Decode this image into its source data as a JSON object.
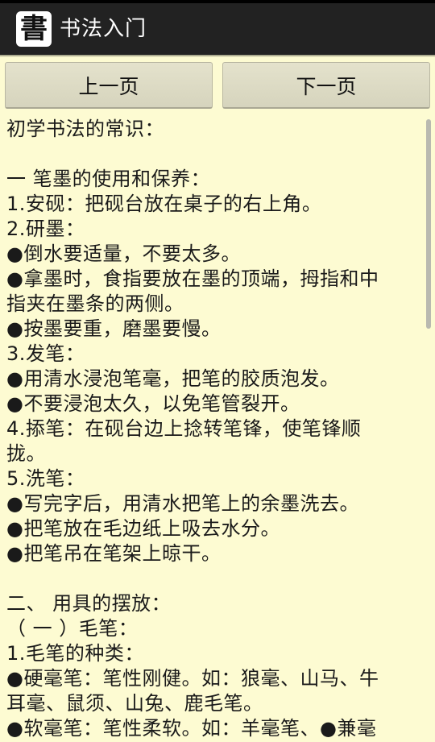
{
  "app_bar": {
    "icon_char": "書",
    "title": "书法入门"
  },
  "nav": {
    "prev_label": "上一页",
    "next_label": "下一页"
  },
  "content": {
    "lines": [
      "初学书法的常识：",
      "",
      "一 笔墨的使用和保养：",
      "1.安砚：把砚台放在桌子的右上角。",
      "2.研墨：",
      "●倒水要适量，不要太多。",
      "●拿墨时，食指要放在墨的顶端，拇指和中",
      "指夹在墨条的两侧。",
      "●按墨要重，磨墨要慢。",
      "3.发笔：",
      "●用清水浸泡笔毫，把笔的胶质泡发。",
      "●不要浸泡太久，以免笔管裂开。",
      "4.掭笔：在砚台边上捻转笔锋，使笔锋顺",
      "拢。",
      "5.洗笔：",
      "●写完字后，用清水把笔上的余墨洗去。",
      "●把笔放在毛边纸上吸去水分。",
      "●把笔吊在笔架上晾干。",
      "",
      "二、 用具的摆放：",
      "（ 一 ）毛笔：",
      "1.毛笔的种类：",
      "●硬毫笔：笔性刚健。如：狼毫、山马、牛",
      "耳毫、鼠须、山兔、鹿毛笔。",
      "●软毫笔：笔性柔软。如：羊毫笔、●兼毫"
    ]
  }
}
